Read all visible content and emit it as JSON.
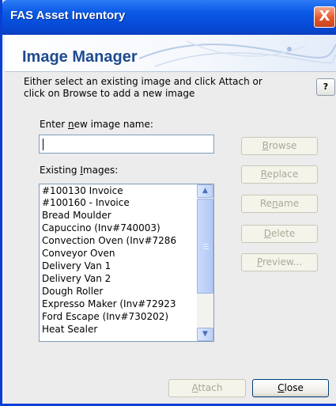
{
  "window": {
    "title": "FAS Asset Inventory",
    "close_glyph": "X"
  },
  "banner": {
    "heading": "Image Manager"
  },
  "instructions": {
    "line1": "Either select an existing image and click Attach or",
    "line2": "click on Browse to add a new image"
  },
  "help_button": {
    "label": "?"
  },
  "name_field": {
    "label_prefix": "Enter ",
    "label_accel": "n",
    "label_suffix": "ew image name:",
    "value": ""
  },
  "existing_images": {
    "label_prefix": "Existing ",
    "label_accel": "I",
    "label_suffix": "mages:",
    "items": [
      "#100130 Invoice",
      "#100160 - Invoice",
      "Bread Moulder",
      "Capuccino (Inv#740003)",
      "Convection Oven (Inv#7286",
      "Conveyor Oven",
      "Delivery Van 1",
      "Delivery Van 2",
      "Dough Roller",
      "Expresso Maker (Inv#72923",
      "Ford Escape (Inv#730202)",
      "Heat Sealer"
    ]
  },
  "side_buttons": {
    "browse": {
      "accel": "B",
      "rest": "rowse"
    },
    "replace": {
      "accel": "R",
      "rest": "eplace"
    },
    "rename_pre": "Re",
    "rename_accel": "n",
    "rename_post": "ame",
    "delete": {
      "accel": "D",
      "rest": "elete"
    },
    "preview": {
      "accel": "P",
      "rest": "review..."
    }
  },
  "footer_buttons": {
    "attach": {
      "accel": "A",
      "rest": "ttach"
    },
    "close": {
      "accel": "C",
      "rest": "lose"
    }
  },
  "colors": {
    "titlebar": "#0b5ae6",
    "heading": "#1e4b8f",
    "disabled_text": "#aca899"
  },
  "icons": [
    "close-icon",
    "scroll-up-icon",
    "scroll-down-icon",
    "banner-swoosh-graphic"
  ]
}
